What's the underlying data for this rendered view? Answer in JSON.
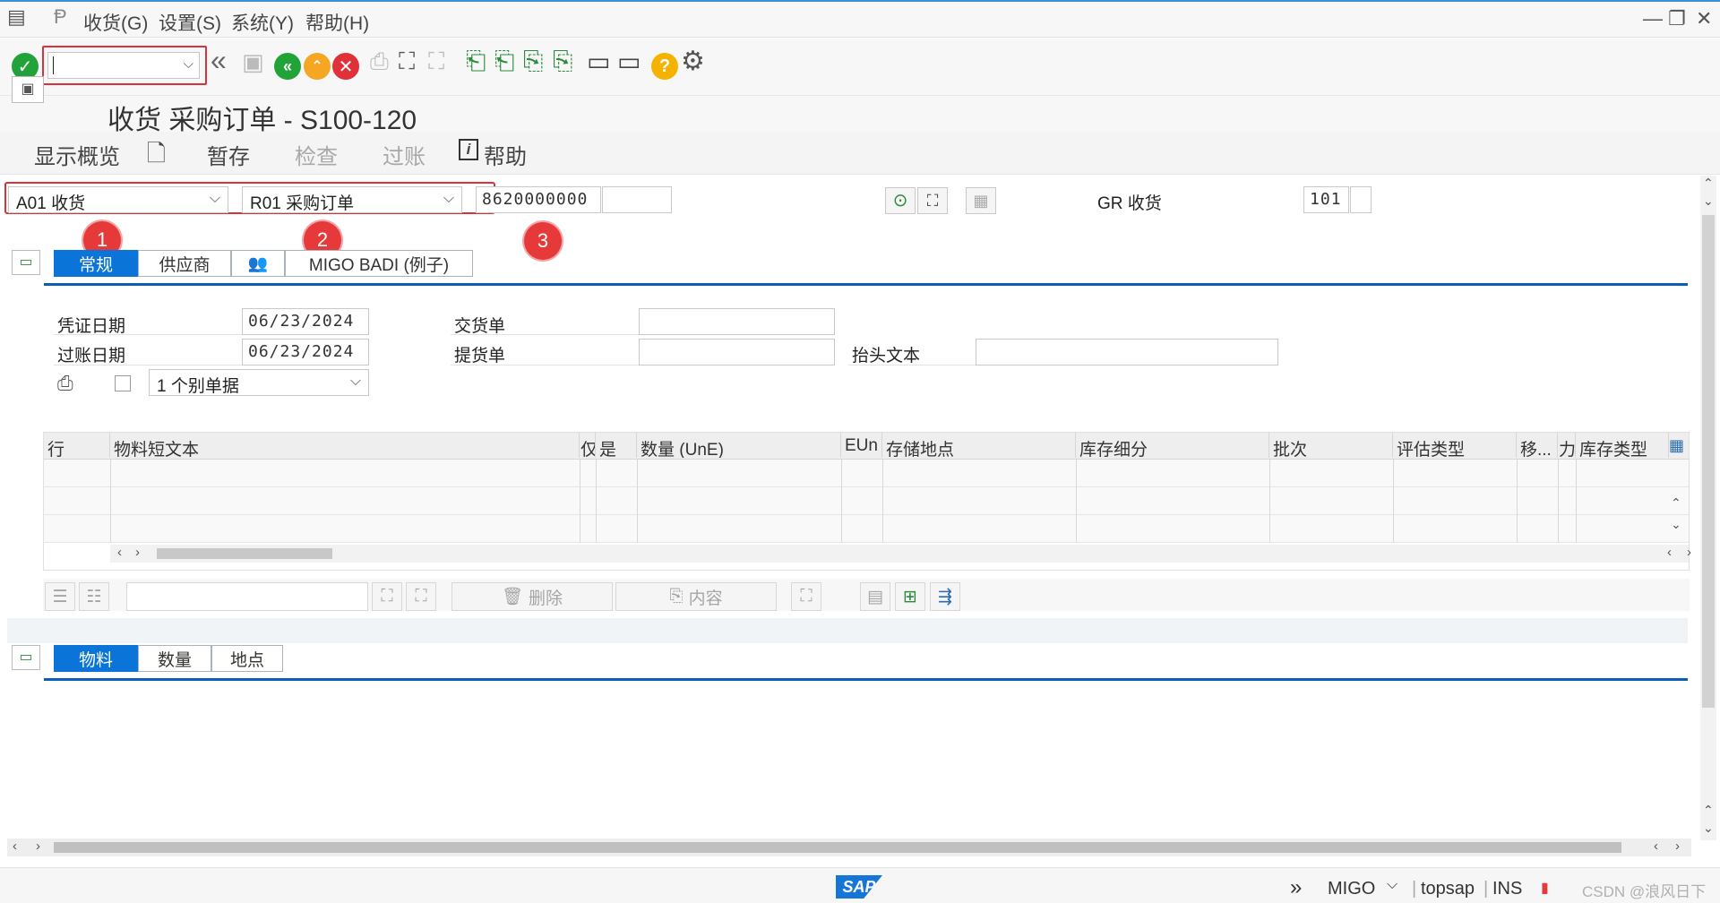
{
  "menu": {
    "items": [
      "收货(G)",
      "设置(S)",
      "系统(Y)",
      "帮助(H)"
    ]
  },
  "toolbar": {
    "command_field_value": ""
  },
  "title": "收货 采购订单 - S100-120",
  "app_toolbar": {
    "overview": "显示概览",
    "hold": "暂存",
    "check": "检查",
    "post": "过账",
    "help": "帮助"
  },
  "header": {
    "action_value": "A01 收货",
    "reference_value": "R01 采购订单",
    "po_number": "8620000000",
    "movement_label": "GR 收货",
    "movement_type": "101",
    "annotations": [
      "1",
      "2",
      "3"
    ]
  },
  "header_tabs": [
    "常规",
    "供应商",
    "MIGO BADI (例子)"
  ],
  "general": {
    "doc_date_label": "凭证日期",
    "doc_date": "06/23/2024",
    "post_date_label": "过账日期",
    "post_date": "06/23/2024",
    "delivery_note_label": "交货单",
    "bill_of_lading_label": "提货单",
    "header_text_label": "抬头文本",
    "print_option": "1 个别单据"
  },
  "item_grid": {
    "columns": [
      "行",
      "物料短文本",
      "仅",
      "是",
      "数量 (UnE)",
      "EUn",
      "存储地点",
      "库存细分",
      "批次",
      "评估类型",
      "移...",
      "力",
      "库存类型"
    ]
  },
  "grid_buttons": {
    "delete": "删除",
    "contents": "内容"
  },
  "detail_tabs": [
    "物料",
    "数量",
    "地点"
  ],
  "status": {
    "transaction": "MIGO",
    "server": "topsap",
    "mode": "INS",
    "watermark": "CSDN @浪风日下"
  },
  "colors": {
    "accent_blue": "#0a74d8",
    "annotation_red": "#e5393a",
    "ok_green": "#21a33a",
    "cancel_red": "#e0303a",
    "exit_orange": "#f5a623"
  }
}
